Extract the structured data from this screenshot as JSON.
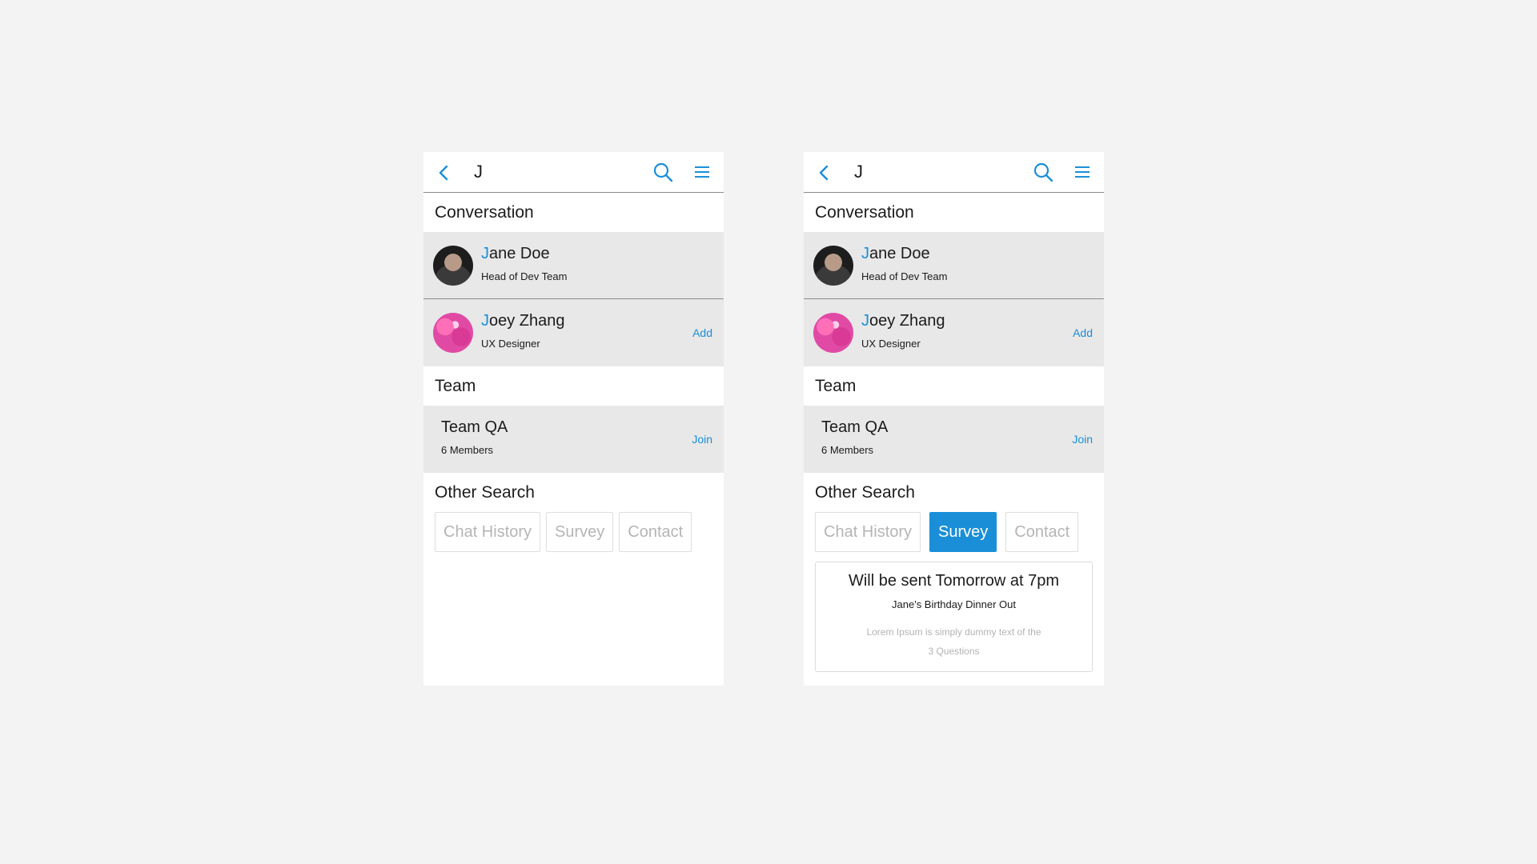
{
  "colors": {
    "accent": "#1a8fd8",
    "row_bg": "#e8e8e8",
    "page_bg": "#f3f3f3"
  },
  "screen_a": {
    "topbar": {
      "back_icon": "chevron-left-icon",
      "query": "J",
      "search_icon": "search-icon",
      "menu_icon": "hamburger-menu-icon"
    },
    "conversation": {
      "heading": "Conversation",
      "items": [
        {
          "highlight": "J",
          "rest": "ane Doe",
          "subtitle": "Head of Dev Team",
          "action": ""
        },
        {
          "highlight": "J",
          "rest": "oey Zhang",
          "subtitle": "UX Designer",
          "action": "Add"
        }
      ]
    },
    "team": {
      "heading": "Team",
      "items": [
        {
          "name": "Team QA",
          "subtitle": "6 Members",
          "action": "Join"
        }
      ]
    },
    "other_search": {
      "heading": "Other Search",
      "chips": [
        "Chat History",
        "Survey",
        "Contact"
      ],
      "selected": ""
    }
  },
  "screen_b": {
    "topbar": {
      "back_icon": "chevron-left-icon",
      "query": "J",
      "search_icon": "search-icon",
      "menu_icon": "hamburger-menu-icon"
    },
    "conversation": {
      "heading": "Conversation",
      "items": [
        {
          "highlight": "J",
          "rest": "ane Doe",
          "subtitle": "Head of Dev Team",
          "action": ""
        },
        {
          "highlight": "J",
          "rest": "oey Zhang",
          "subtitle": "UX Designer",
          "action": "Add"
        }
      ]
    },
    "team": {
      "heading": "Team",
      "items": [
        {
          "name": "Team QA",
          "subtitle": "6 Members",
          "action": "Join"
        }
      ]
    },
    "other_search": {
      "heading": "Other Search",
      "chips": [
        "Chat History",
        "Survey",
        "Contact"
      ],
      "selected": "Survey"
    },
    "survey_card": {
      "title": "Will be sent Tomorrow at 7pm",
      "subtitle": "Jane's Birthday Dinner Out",
      "body_line1": "Lorem Ipsum is simply dummy text of the",
      "body_line2": "3 Questions"
    }
  }
}
